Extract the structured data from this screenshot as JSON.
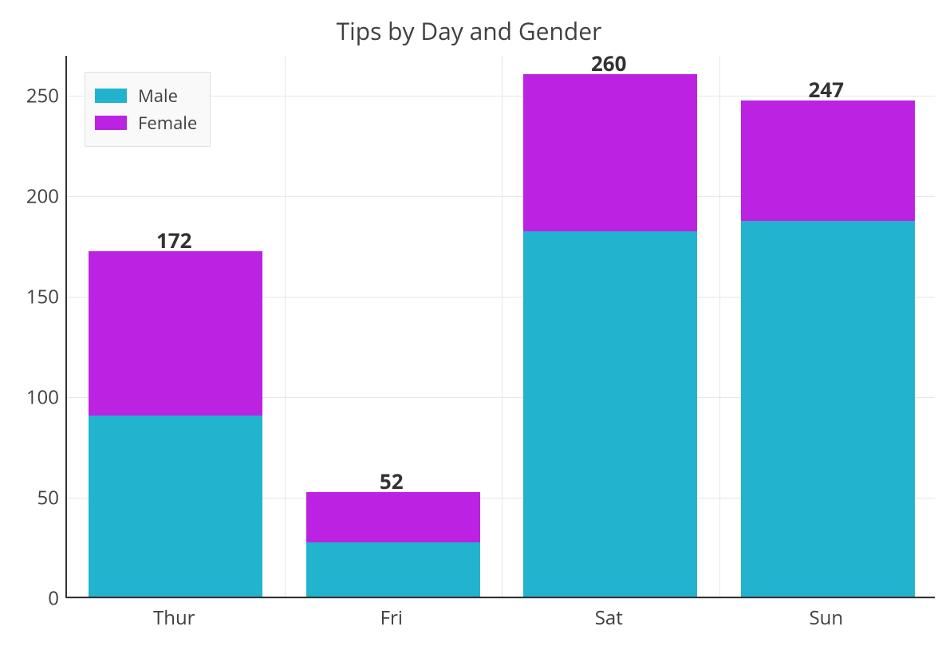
{
  "chart_data": {
    "type": "bar",
    "title": "Tips by Day and Gender",
    "categories": [
      "Thur",
      "Fri",
      "Sat",
      "Sun"
    ],
    "series": [
      {
        "name": "Male",
        "values": [
          90,
          27,
          182,
          187
        ],
        "color": "#22b3ce"
      },
      {
        "name": "Female",
        "values": [
          82,
          25,
          78,
          60
        ],
        "color": "#bb22e2"
      }
    ],
    "totals": [
      172,
      52,
      260,
      247
    ],
    "ylim": [
      0,
      270
    ],
    "y_ticks": [
      0,
      50,
      100,
      150,
      200,
      250
    ],
    "xlabel": "",
    "ylabel": "",
    "legend_position": "upper-left"
  }
}
